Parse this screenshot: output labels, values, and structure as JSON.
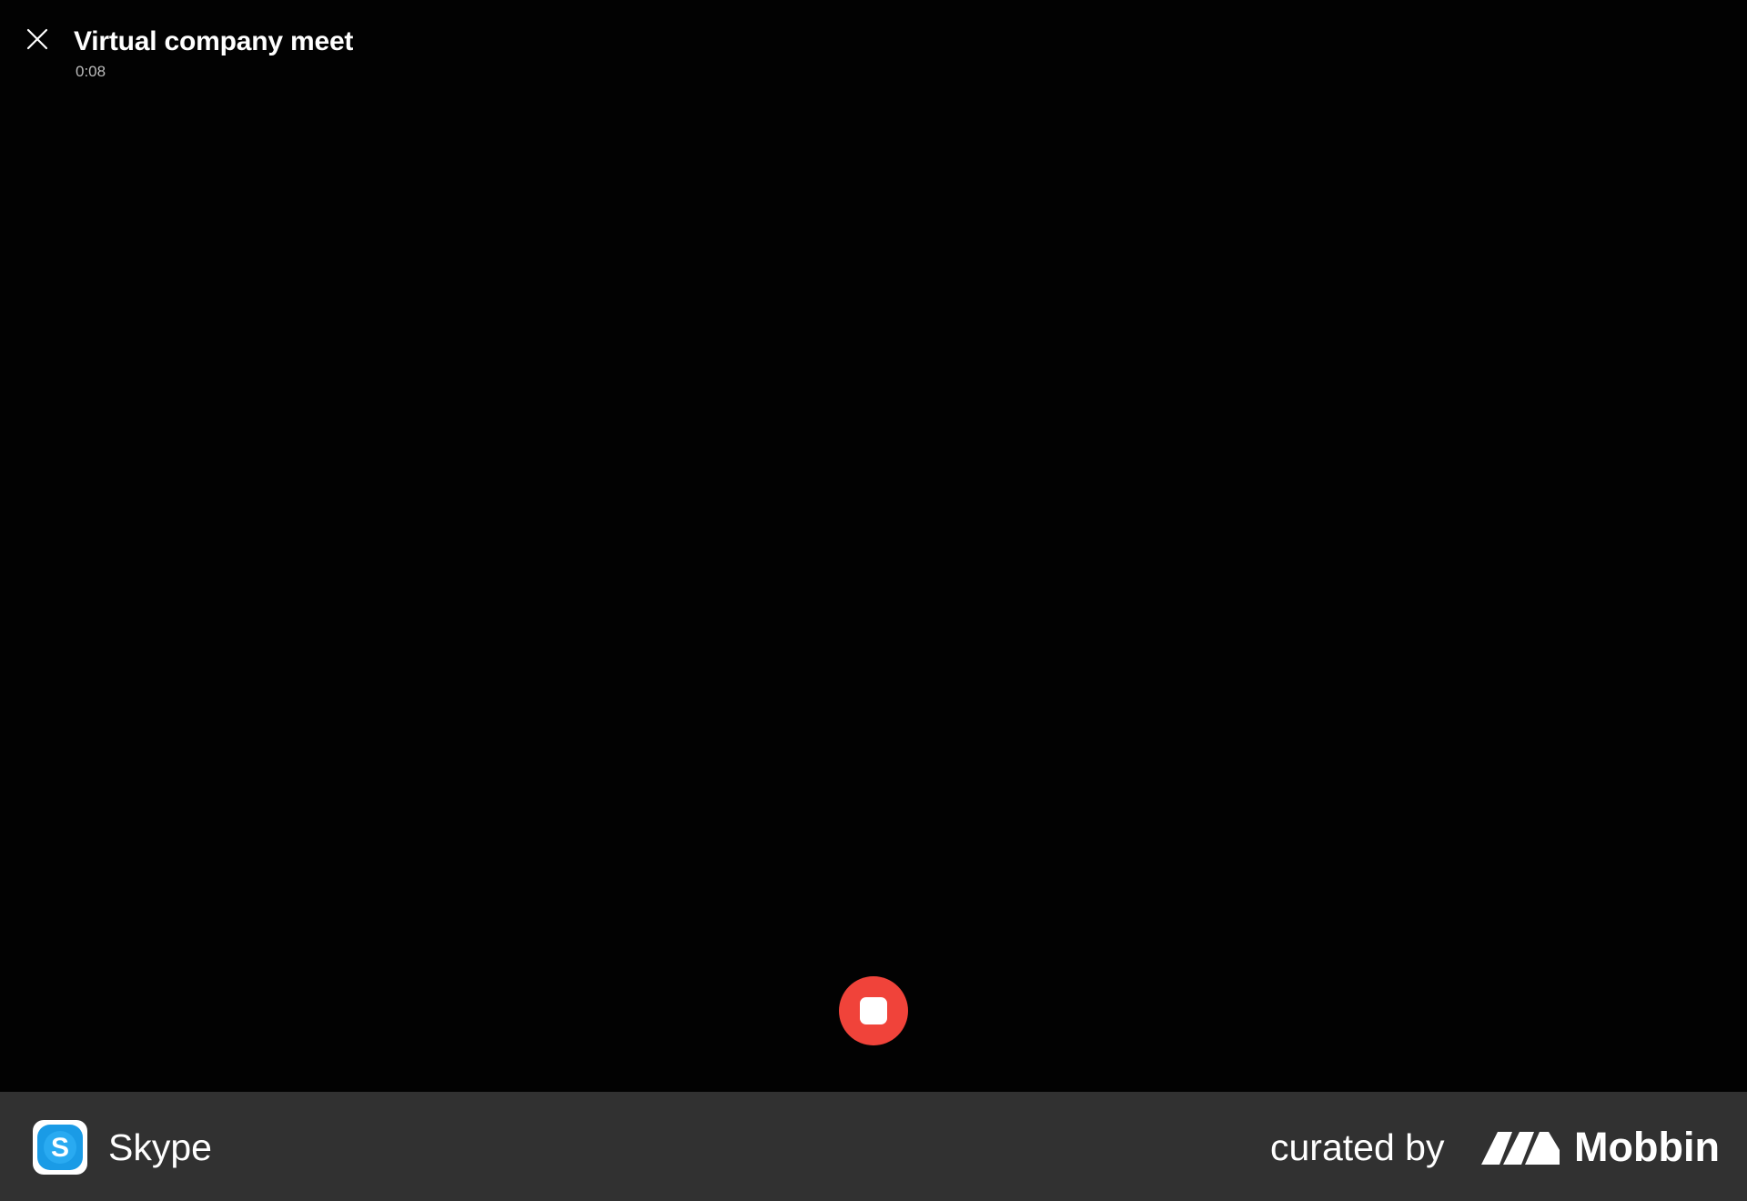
{
  "call": {
    "title": "Virtual company meet",
    "timer": "0:08"
  },
  "icons": {
    "close": "close-icon",
    "stop": "stop-icon",
    "app": "skype-icon",
    "brand": "mobbin-logo-icon"
  },
  "colors": {
    "background": "#020202",
    "stop_button": "#f0433a",
    "footer": "#313131",
    "skype_blue": "#1a9be6"
  },
  "footer": {
    "app_name": "Skype",
    "curated_label": "curated by",
    "brand_name": "Mobbin"
  }
}
